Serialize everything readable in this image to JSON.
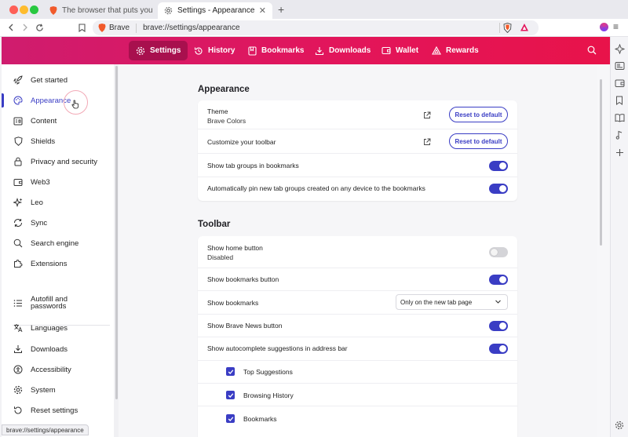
{
  "browser": {
    "tabs": [
      {
        "title": "The browser that puts you first | B",
        "active": false
      },
      {
        "title": "Settings - Appearance",
        "active": true
      }
    ],
    "new_tab": "+",
    "omnibox": {
      "brand": "Brave",
      "url": "brave://settings/appearance"
    },
    "status_url": "brave://settings/appearance"
  },
  "header": {
    "nav": [
      {
        "label": "Settings",
        "icon": "gear-icon",
        "active": true
      },
      {
        "label": "History",
        "icon": "history-icon",
        "active": false
      },
      {
        "label": "Bookmarks",
        "icon": "bookmark-icon",
        "active": false
      },
      {
        "label": "Downloads",
        "icon": "download-icon",
        "active": false
      },
      {
        "label": "Wallet",
        "icon": "wallet-icon",
        "active": false
      },
      {
        "label": "Rewards",
        "icon": "rewards-icon",
        "active": false
      }
    ]
  },
  "sidebar": {
    "items": [
      {
        "label": "Get started",
        "icon": "rocket-icon"
      },
      {
        "label": "Appearance",
        "icon": "palette-icon",
        "active": true
      },
      {
        "label": "Content",
        "icon": "content-icon"
      },
      {
        "label": "Shields",
        "icon": "shield-icon"
      },
      {
        "label": "Privacy and security",
        "icon": "lock-icon"
      },
      {
        "label": "Web3",
        "icon": "wallet-icon"
      },
      {
        "label": "Leo",
        "icon": "sparkle-icon"
      },
      {
        "label": "Sync",
        "icon": "sync-icon"
      },
      {
        "label": "Search engine",
        "icon": "search-icon"
      },
      {
        "label": "Extensions",
        "icon": "puzzle-icon"
      },
      {
        "label": "Autofill and passwords",
        "icon": "list-icon"
      },
      {
        "label": "Languages",
        "icon": "translate-icon"
      },
      {
        "label": "Downloads",
        "icon": "download-icon"
      },
      {
        "label": "Accessibility",
        "icon": "accessibility-icon"
      },
      {
        "label": "System",
        "icon": "gear-icon"
      },
      {
        "label": "Reset settings",
        "icon": "reset-icon"
      }
    ]
  },
  "appearance": {
    "title": "Appearance",
    "theme_label": "Theme",
    "theme_value": "Brave Colors",
    "reset_label": "Reset to default",
    "customize_toolbar": "Customize your toolbar",
    "tab_groups": "Show tab groups in bookmarks",
    "tab_groups_on": true,
    "auto_pin": "Automatically pin new tab groups created on any device to the bookmarks",
    "auto_pin_on": true
  },
  "toolbar_section": {
    "title": "Toolbar",
    "home_button": "Show home button",
    "home_button_status": "Disabled",
    "home_button_on": false,
    "bookmarks_button": "Show bookmarks button",
    "bookmarks_button_on": true,
    "show_bookmarks": "Show bookmarks",
    "show_bookmarks_value": "Only on the new tab page",
    "brave_news": "Show Brave News button",
    "brave_news_on": true,
    "autocomplete": "Show autocomplete suggestions in address bar",
    "autocomplete_on": true,
    "suggestions": [
      {
        "label": "Top Suggestions",
        "checked": true
      },
      {
        "label": "Browsing History",
        "checked": true
      },
      {
        "label": "Bookmarks",
        "checked": true
      }
    ]
  },
  "colors": {
    "accent": "#3a3dc4",
    "header_start": "#cf1c6e",
    "header_end": "#e8134a"
  }
}
